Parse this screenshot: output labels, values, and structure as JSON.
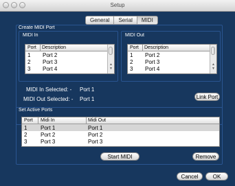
{
  "window": {
    "title": "Setup"
  },
  "tabs": [
    {
      "label": "General"
    },
    {
      "label": "Serial"
    },
    {
      "label": "MIDI"
    }
  ],
  "create_midi_port": {
    "title": "Create MIDI Port",
    "midi_in": {
      "title": "MIDI In",
      "headers": [
        "Port",
        "Description"
      ],
      "rows": [
        {
          "port": "1",
          "description": "Port 2"
        },
        {
          "port": "2",
          "description": "Port 3"
        },
        {
          "port": "3",
          "description": "Port 4"
        }
      ]
    },
    "midi_out": {
      "title": "MIDI Out",
      "headers": [
        "Port",
        "Description"
      ],
      "rows": [
        {
          "port": "1",
          "description": "Port 2"
        },
        {
          "port": "2",
          "description": "Port 3"
        },
        {
          "port": "3",
          "description": "Port 4"
        }
      ]
    },
    "midi_in_selected_label": "MIDI In Selected: -",
    "midi_in_selected_value": "Port 1",
    "midi_out_selected_label": "MIDI Out Selected: -",
    "midi_out_selected_value": "Port 1",
    "link_port_label": "Link Port"
  },
  "set_active_ports": {
    "title": "Set Active Ports",
    "headers": [
      "Port",
      "Midi In",
      "Midi Out"
    ],
    "rows": [
      {
        "port": "1",
        "midi_in": "Port 1",
        "midi_out": "Port 1"
      },
      {
        "port": "2",
        "midi_in": "Port 2",
        "midi_out": "Port 2"
      },
      {
        "port": "3",
        "midi_in": "Port 3",
        "midi_out": "Port 3"
      }
    ],
    "start_midi_label": "Start MIDI",
    "remove_label": "Remove"
  },
  "footer": {
    "cancel_label": "Cancel",
    "ok_label": "OK"
  },
  "colors": {
    "background": "#17375e",
    "panel_border": "#2a5591",
    "text": "#ffffff",
    "selection": "#d6d6d6"
  }
}
